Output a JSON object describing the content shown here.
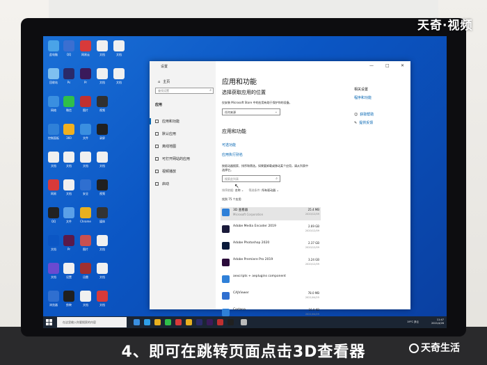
{
  "watermark": {
    "top": "天奇·视频",
    "bottom": "天奇生活"
  },
  "caption": "4、即可在跳转页面点击3D查看器",
  "colors": {
    "desktop": "#0b56c4",
    "accent": "#0063b1",
    "taskbar": "#1b2533"
  },
  "desktop": {
    "icons": [
      {
        "label": "此电脑",
        "color": "#4aa3e8"
      },
      {
        "label": "QQ",
        "color": "#3b6fd1"
      },
      {
        "label": "网易云",
        "color": "#d83a3a"
      },
      {
        "label": "文档",
        "color": "#f0f0f0"
      },
      {
        "label": "文档",
        "color": "#f0f0f0"
      },
      {
        "label": "回收站",
        "color": "#7fc0f0"
      },
      {
        "label": "Ps",
        "color": "#2a2a6a"
      },
      {
        "label": "Pr",
        "color": "#3a1a5a"
      },
      {
        "label": "文档",
        "color": "#f0f0f0"
      },
      {
        "label": "文档",
        "color": "#f0f0f0"
      },
      {
        "label": "网络",
        "color": "#3a8fe0"
      },
      {
        "label": "微信",
        "color": "#2fbf4a"
      },
      {
        "label": "图片",
        "color": "#c03030"
      },
      {
        "label": "视频",
        "color": "#303030"
      },
      {
        "label": "",
        "color": "#0b56c4"
      },
      {
        "label": "控制面板",
        "color": "#2f80d8"
      },
      {
        "label": "360",
        "color": "#f0b020"
      },
      {
        "label": "文件",
        "color": "#3a8fe0"
      },
      {
        "label": "录屏",
        "color": "#202020"
      },
      {
        "label": "",
        "color": "#0b56c4"
      },
      {
        "label": "文档",
        "color": "#f0f0f0"
      },
      {
        "label": "文档",
        "color": "#f0f0f0"
      },
      {
        "label": "文档",
        "color": "#f0f0f0"
      },
      {
        "label": "文档",
        "color": "#f0f0f0"
      },
      {
        "label": "",
        "color": "#0b56c4"
      },
      {
        "label": "网易",
        "color": "#d83a3a"
      },
      {
        "label": "文档",
        "color": "#f0f0f0"
      },
      {
        "label": "安全",
        "color": "#2f6fd0"
      },
      {
        "label": "视频",
        "color": "#202020"
      },
      {
        "label": "",
        "color": "#0b56c4"
      },
      {
        "label": "QQ",
        "color": "#222222"
      },
      {
        "label": "文件",
        "color": "#5aa0e8"
      },
      {
        "label": "Chrome",
        "color": "#e8b020"
      },
      {
        "label": "媒体",
        "color": "#333333"
      },
      {
        "label": "",
        "color": "#0b56c4"
      },
      {
        "label": "文档",
        "color": "#0b56c4"
      },
      {
        "label": "Pr",
        "color": "#5a1a4a"
      },
      {
        "label": "图片",
        "color": "#c85050"
      },
      {
        "label": "文档",
        "color": "#f0f0f0"
      },
      {
        "label": "",
        "color": "#0b56c4"
      },
      {
        "label": "文档",
        "color": "#6a4ad0"
      },
      {
        "label": "设置",
        "color": "#f0f0f0"
      },
      {
        "label": "迅雷",
        "color": "#a03030"
      },
      {
        "label": "文档",
        "color": "#f0f0f0"
      },
      {
        "label": "",
        "color": "#0b56c4"
      },
      {
        "label": "浏览器",
        "color": "#2f6fd0"
      },
      {
        "label": "剪映",
        "color": "#202020"
      },
      {
        "label": "文档",
        "color": "#f0f0f0"
      },
      {
        "label": "文档",
        "color": "#d83a3a"
      },
      {
        "label": "",
        "color": "#0b56c4"
      }
    ]
  },
  "settings_window": {
    "title": "设置",
    "controls": {
      "minimize": "—",
      "maximize": "□",
      "close": "✕"
    },
    "sidebar": {
      "home": "主页",
      "search_placeholder": "查找设置",
      "section": "应用",
      "items": [
        "应用和功能",
        "默认应用",
        "离线地图",
        "可打开网站的应用",
        "视频播放",
        "启动"
      ]
    },
    "main": {
      "title": "应用和功能",
      "subtitle": "选择获取应用的位置",
      "desc": "仅安装 Microsoft Store 中的应用有助于保护你的设备。",
      "source_value": "任何来源",
      "section": "应用和功能",
      "link1": "可选功能",
      "link2": "应用执行别名",
      "hint_line1": "按驱动器搜索、排序和筛选。如果要卸载或移动某个应用，请从列表中",
      "hint_line2": "选择它。",
      "search_placeholder": "搜索此列表",
      "sort_label": "排序依据:",
      "sort_value": "名称",
      "filter_label": "筛选条件:",
      "filter_value": "所有驱动器",
      "count": "找到 75 个应用",
      "apps": [
        {
          "name": "3D 查看器",
          "publisher": "Microsoft Corporation",
          "size": "25.4 MB",
          "date": "2020/12/09",
          "color": "#2f80d8"
        },
        {
          "name": "Adobe Media Encoder 2019",
          "publisher": "",
          "size": "2.69 GB",
          "date": "2020/12/09",
          "color": "#1a1a3a"
        },
        {
          "name": "Adobe Photoshop 2020",
          "publisher": "",
          "size": "2.37 GB",
          "date": "2020/12/09",
          "color": "#0a1a3a"
        },
        {
          "name": "Adobe Premiere Pro 2019",
          "publisher": "",
          "size": "3.24 GB",
          "date": "2020/12/09",
          "color": "#2a0a3a"
        },
        {
          "name": "aexcripts + aeplugins component",
          "publisher": "",
          "size": "",
          "date": "",
          "color": "#2f80d8"
        },
        {
          "name": "CAJViewer",
          "publisher": "",
          "size": "78.0 MB",
          "date": "2021/04/25",
          "color": "#2f6fd0"
        },
        {
          "name": "Cortana",
          "publisher": "",
          "size": "16.0 KB",
          "date": "2021/04/25",
          "color": "#2f80d8"
        }
      ]
    },
    "right": {
      "related": "相关设置",
      "related_link": "程序和功能",
      "help": "获取帮助",
      "feedback": "提供反馈"
    }
  },
  "taskbar": {
    "search_placeholder": "在这里输入你要搜索的内容",
    "tray_line1": "11:47",
    "tray_line2": "2021/4/26",
    "tray_weather": "19°C 多云"
  }
}
